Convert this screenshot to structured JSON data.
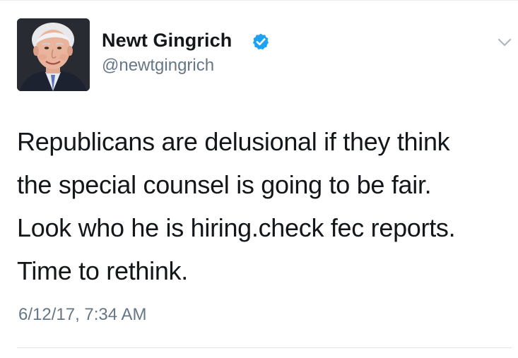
{
  "tweet": {
    "author": {
      "display_name": "Newt Gingrich",
      "username": "@newtgingrich",
      "verified": true,
      "avatar_icon": "profile-photo"
    },
    "text_lines": [
      "Republicans are delusional if they think",
      "the special counsel is going to be fair.",
      "Look who he is hiring.check fec reports.",
      "Time to rethink."
    ],
    "timestamp": "6/12/17, 7:34 AM",
    "menu_icon": "chevron-down-icon"
  },
  "colors": {
    "primary_text": "#14171a",
    "secondary_text": "#657786",
    "verified_badge": "#1da1f2",
    "chevron": "#aab8c2",
    "divider": "#e6ecf0"
  }
}
